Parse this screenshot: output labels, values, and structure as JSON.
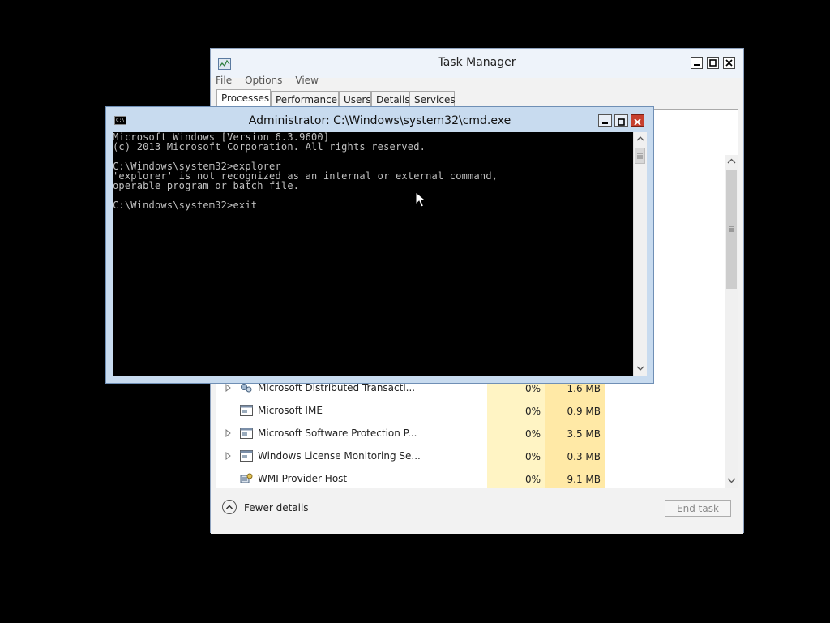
{
  "taskmanager": {
    "title": "Task Manager",
    "menu": [
      "File",
      "Options",
      "View"
    ],
    "tabs": [
      "Processes",
      "Performance",
      "Users",
      "Details",
      "Services"
    ],
    "rows": [
      {
        "name": "Microsoft Distributed Transacti...",
        "cpu": "0%",
        "mem": "1.6 MB",
        "expandable": true,
        "icon": "service-icon"
      },
      {
        "name": "Microsoft IME",
        "cpu": "0%",
        "mem": "0.9 MB",
        "expandable": false,
        "icon": "app-window-icon"
      },
      {
        "name": "Microsoft Software Protection P...",
        "cpu": "0%",
        "mem": "3.5 MB",
        "expandable": true,
        "icon": "app-window-icon"
      },
      {
        "name": "Windows License Monitoring Se...",
        "cpu": "0%",
        "mem": "0.3 MB",
        "expandable": true,
        "icon": "app-window-icon"
      },
      {
        "name": "WMI Provider Host",
        "cpu": "0%",
        "mem": "9.1 MB",
        "expandable": false,
        "icon": "wmi-icon"
      }
    ],
    "footer": {
      "fewer_details": "Fewer details",
      "end_task": "End task"
    }
  },
  "cmd": {
    "title": "Administrator: C:\\Windows\\system32\\cmd.exe",
    "icon_text": "C:\\",
    "lines": [
      "Microsoft Windows [Version 6.3.9600]",
      "(c) 2013 Microsoft Corporation. All rights reserved.",
      "",
      "C:\\Windows\\system32>explorer",
      "'explorer' is not recognized as an internal or external command,",
      "operable program or batch file.",
      "",
      "C:\\Windows\\system32>exit"
    ]
  },
  "colors": {
    "desktop": "#000000",
    "cpu_cell": "#fff4c4",
    "mem_cell": "#ffe9a6",
    "cmd_frame": "#c8dbef",
    "close_button": "#c7402f"
  }
}
